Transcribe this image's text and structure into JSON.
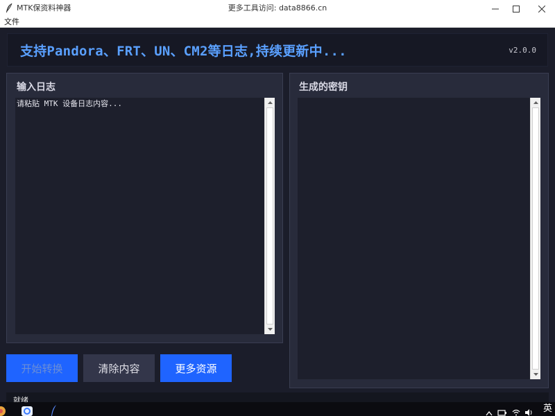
{
  "window": {
    "title": "MTK保资料神器",
    "center_title": "更多工具访问: data8866.cn"
  },
  "menu": {
    "items": [
      {
        "label": "文件"
      }
    ]
  },
  "banner": {
    "title": "支持Pandora、FRT、UN、CM2等日志,持续更新中...",
    "version": "v2.0.0",
    "title_color": "#5aa0ff"
  },
  "input_panel": {
    "title": "输入日志",
    "placeholder": "请粘贴 MTK 设备日志内容..."
  },
  "output_panel": {
    "title": "生成的密钥",
    "value": ""
  },
  "buttons": {
    "start": "开始转换",
    "clear": "清除内容",
    "more": "更多资源",
    "accent_color": "#1f64ff"
  },
  "status": {
    "text": "就绪"
  },
  "taskbar": {
    "tray_lang": "英"
  }
}
